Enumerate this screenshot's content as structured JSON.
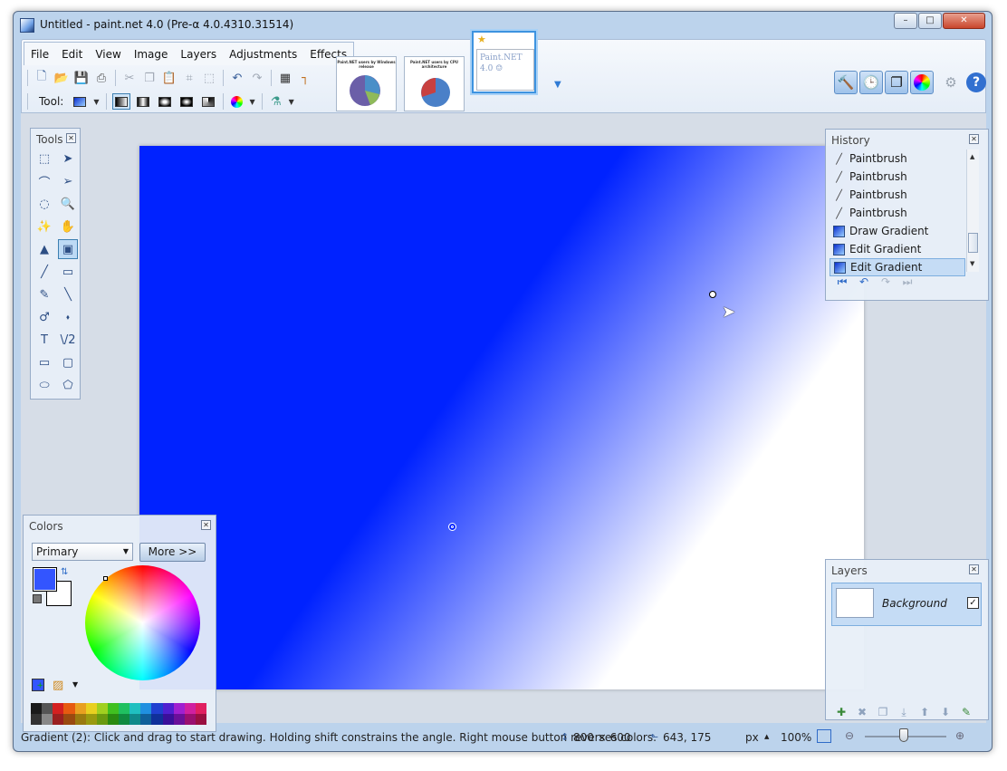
{
  "window": {
    "title": "Untitled - paint.net 4.0 (Pre-α 4.0.4310.31514)",
    "controls": {
      "minimize": "–",
      "maximize": "□",
      "close": "✕"
    }
  },
  "menu": [
    "File",
    "Edit",
    "View",
    "Image",
    "Layers",
    "Adjustments",
    "Effects"
  ],
  "toolbar": {
    "tool_label": "Tool:",
    "icons": [
      "new-icon",
      "open-icon",
      "save-icon",
      "print-icon",
      "cut-icon",
      "copy-icon",
      "paste-icon",
      "crop-icon",
      "deselect-icon",
      "undo-icon",
      "redo-icon",
      "grid-icon",
      "ruler-icon"
    ]
  },
  "image_tabs": [
    {
      "title": "Paint.NET users by Windows release",
      "kind": "pie-chart"
    },
    {
      "title": "Paint.NET users by CPU architecture",
      "kind": "pie-chart"
    },
    {
      "title": "",
      "kind": "sketch",
      "sketch_text": "Paint.NET 4.0 ☺",
      "unsaved": true
    }
  ],
  "right_buttons": [
    "tools-window-icon",
    "history-window-icon",
    "layers-window-icon",
    "colors-window-icon",
    "settings-icon",
    "help-icon"
  ],
  "help_label": "?",
  "tools_panel": {
    "title": "Tools",
    "active_tool": "gradient",
    "tools": [
      {
        "name": "rectangle-select",
        "glyph": "⬚"
      },
      {
        "name": "move-selection",
        "glyph": "➤"
      },
      {
        "name": "lasso-select",
        "glyph": "⌒"
      },
      {
        "name": "move-selected",
        "glyph": "➢"
      },
      {
        "name": "ellipse-select",
        "glyph": "◌"
      },
      {
        "name": "zoom",
        "glyph": "🔍"
      },
      {
        "name": "magic-wand",
        "glyph": "✨"
      },
      {
        "name": "pan",
        "glyph": "✋"
      },
      {
        "name": "paint-bucket",
        "glyph": "▲"
      },
      {
        "name": "gradient",
        "glyph": "▣"
      },
      {
        "name": "paintbrush",
        "glyph": "╱"
      },
      {
        "name": "eraser",
        "glyph": "▭"
      },
      {
        "name": "pencil",
        "glyph": "✎"
      },
      {
        "name": "color-picker",
        "glyph": "╲"
      },
      {
        "name": "clone-stamp",
        "glyph": "♂"
      },
      {
        "name": "recolor",
        "glyph": "⬪"
      },
      {
        "name": "text",
        "glyph": "T"
      },
      {
        "name": "line-curve",
        "glyph": "\\/2"
      },
      {
        "name": "rectangle",
        "glyph": "▭"
      },
      {
        "name": "rounded-rectangle",
        "glyph": "▢"
      },
      {
        "name": "ellipse",
        "glyph": "⬭"
      },
      {
        "name": "freeform-shape",
        "glyph": "⬠"
      }
    ]
  },
  "colors_panel": {
    "title": "Colors",
    "selected": "Primary",
    "more_label": "More >>",
    "primary_color": "#3355ff",
    "secondary_color": "#ffffff",
    "palette_top": [
      "#1a1a1a",
      "#555555",
      "#d42020",
      "#e65a10",
      "#e8a020",
      "#e8d020",
      "#a0d020",
      "#40c020",
      "#20c060",
      "#20c0c0",
      "#2090e0",
      "#2040d0",
      "#5020d0",
      "#a020d0",
      "#d020a0",
      "#e02060"
    ],
    "palette_bottom": [
      "#333333",
      "#888888",
      "#9a2020",
      "#9a4a10",
      "#9a7a10",
      "#9a9a10",
      "#6a9a10",
      "#2a8a10",
      "#108a40",
      "#108a8a",
      "#10609a",
      "#10309a",
      "#3a109a",
      "#6a109a",
      "#9a1070",
      "#9a1040"
    ]
  },
  "history_panel": {
    "title": "History",
    "items": [
      {
        "label": "Paintbrush",
        "icon": "paintbrush-icon",
        "selected": false
      },
      {
        "label": "Paintbrush",
        "icon": "paintbrush-icon",
        "selected": false
      },
      {
        "label": "Paintbrush",
        "icon": "paintbrush-icon",
        "selected": false
      },
      {
        "label": "Paintbrush",
        "icon": "paintbrush-icon",
        "selected": false
      },
      {
        "label": "Draw Gradient",
        "icon": "gradient-icon",
        "selected": false
      },
      {
        "label": "Edit Gradient",
        "icon": "gradient-icon",
        "selected": false
      },
      {
        "label": "Edit Gradient",
        "icon": "gradient-icon",
        "selected": true
      }
    ]
  },
  "layers_panel": {
    "title": "Layers",
    "layers": [
      {
        "name": "Background",
        "visible": true
      }
    ],
    "actions": [
      "add-layer-icon",
      "delete-layer-icon",
      "duplicate-layer-icon",
      "merge-layer-down-icon",
      "move-layer-up-icon",
      "move-layer-down-icon",
      "layer-properties-icon"
    ]
  },
  "canvas": {
    "gradient_from": "#0022ff",
    "gradient_to": "#ffffff"
  },
  "status": {
    "hint": "Gradient (2): Click and drag to start drawing. Holding shift constrains the angle. Right mouse button reverses colors.",
    "image_size": "800 × 600",
    "cursor_position": "643, 175",
    "unit": "px",
    "zoom": "100%",
    "zoom_fraction": 0.5
  }
}
